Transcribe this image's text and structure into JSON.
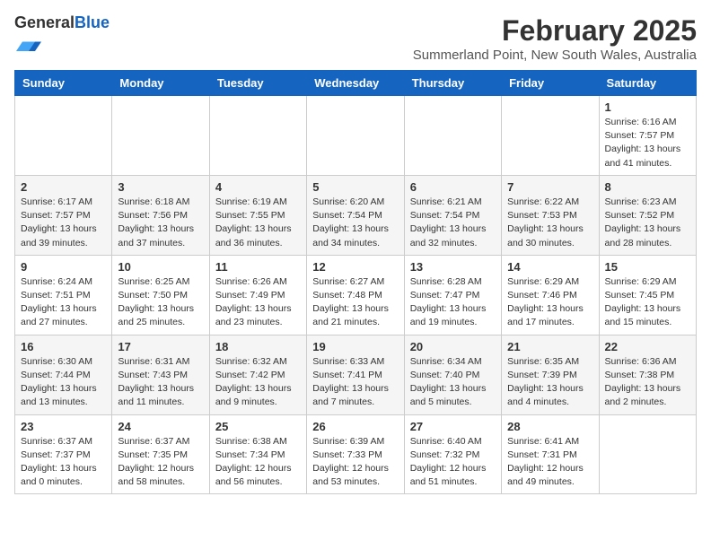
{
  "logo": {
    "general": "General",
    "blue": "Blue"
  },
  "header": {
    "title": "February 2025",
    "subtitle": "Summerland Point, New South Wales, Australia"
  },
  "weekdays": [
    "Sunday",
    "Monday",
    "Tuesday",
    "Wednesday",
    "Thursday",
    "Friday",
    "Saturday"
  ],
  "weeks": [
    [
      {
        "day": "",
        "info": ""
      },
      {
        "day": "",
        "info": ""
      },
      {
        "day": "",
        "info": ""
      },
      {
        "day": "",
        "info": ""
      },
      {
        "day": "",
        "info": ""
      },
      {
        "day": "",
        "info": ""
      },
      {
        "day": "1",
        "info": "Sunrise: 6:16 AM\nSunset: 7:57 PM\nDaylight: 13 hours\nand 41 minutes."
      }
    ],
    [
      {
        "day": "2",
        "info": "Sunrise: 6:17 AM\nSunset: 7:57 PM\nDaylight: 13 hours\nand 39 minutes."
      },
      {
        "day": "3",
        "info": "Sunrise: 6:18 AM\nSunset: 7:56 PM\nDaylight: 13 hours\nand 37 minutes."
      },
      {
        "day": "4",
        "info": "Sunrise: 6:19 AM\nSunset: 7:55 PM\nDaylight: 13 hours\nand 36 minutes."
      },
      {
        "day": "5",
        "info": "Sunrise: 6:20 AM\nSunset: 7:54 PM\nDaylight: 13 hours\nand 34 minutes."
      },
      {
        "day": "6",
        "info": "Sunrise: 6:21 AM\nSunset: 7:54 PM\nDaylight: 13 hours\nand 32 minutes."
      },
      {
        "day": "7",
        "info": "Sunrise: 6:22 AM\nSunset: 7:53 PM\nDaylight: 13 hours\nand 30 minutes."
      },
      {
        "day": "8",
        "info": "Sunrise: 6:23 AM\nSunset: 7:52 PM\nDaylight: 13 hours\nand 28 minutes."
      }
    ],
    [
      {
        "day": "9",
        "info": "Sunrise: 6:24 AM\nSunset: 7:51 PM\nDaylight: 13 hours\nand 27 minutes."
      },
      {
        "day": "10",
        "info": "Sunrise: 6:25 AM\nSunset: 7:50 PM\nDaylight: 13 hours\nand 25 minutes."
      },
      {
        "day": "11",
        "info": "Sunrise: 6:26 AM\nSunset: 7:49 PM\nDaylight: 13 hours\nand 23 minutes."
      },
      {
        "day": "12",
        "info": "Sunrise: 6:27 AM\nSunset: 7:48 PM\nDaylight: 13 hours\nand 21 minutes."
      },
      {
        "day": "13",
        "info": "Sunrise: 6:28 AM\nSunset: 7:47 PM\nDaylight: 13 hours\nand 19 minutes."
      },
      {
        "day": "14",
        "info": "Sunrise: 6:29 AM\nSunset: 7:46 PM\nDaylight: 13 hours\nand 17 minutes."
      },
      {
        "day": "15",
        "info": "Sunrise: 6:29 AM\nSunset: 7:45 PM\nDaylight: 13 hours\nand 15 minutes."
      }
    ],
    [
      {
        "day": "16",
        "info": "Sunrise: 6:30 AM\nSunset: 7:44 PM\nDaylight: 13 hours\nand 13 minutes."
      },
      {
        "day": "17",
        "info": "Sunrise: 6:31 AM\nSunset: 7:43 PM\nDaylight: 13 hours\nand 11 minutes."
      },
      {
        "day": "18",
        "info": "Sunrise: 6:32 AM\nSunset: 7:42 PM\nDaylight: 13 hours\nand 9 minutes."
      },
      {
        "day": "19",
        "info": "Sunrise: 6:33 AM\nSunset: 7:41 PM\nDaylight: 13 hours\nand 7 minutes."
      },
      {
        "day": "20",
        "info": "Sunrise: 6:34 AM\nSunset: 7:40 PM\nDaylight: 13 hours\nand 5 minutes."
      },
      {
        "day": "21",
        "info": "Sunrise: 6:35 AM\nSunset: 7:39 PM\nDaylight: 13 hours\nand 4 minutes."
      },
      {
        "day": "22",
        "info": "Sunrise: 6:36 AM\nSunset: 7:38 PM\nDaylight: 13 hours\nand 2 minutes."
      }
    ],
    [
      {
        "day": "23",
        "info": "Sunrise: 6:37 AM\nSunset: 7:37 PM\nDaylight: 13 hours\nand 0 minutes."
      },
      {
        "day": "24",
        "info": "Sunrise: 6:37 AM\nSunset: 7:35 PM\nDaylight: 12 hours\nand 58 minutes."
      },
      {
        "day": "25",
        "info": "Sunrise: 6:38 AM\nSunset: 7:34 PM\nDaylight: 12 hours\nand 56 minutes."
      },
      {
        "day": "26",
        "info": "Sunrise: 6:39 AM\nSunset: 7:33 PM\nDaylight: 12 hours\nand 53 minutes."
      },
      {
        "day": "27",
        "info": "Sunrise: 6:40 AM\nSunset: 7:32 PM\nDaylight: 12 hours\nand 51 minutes."
      },
      {
        "day": "28",
        "info": "Sunrise: 6:41 AM\nSunset: 7:31 PM\nDaylight: 12 hours\nand 49 minutes."
      },
      {
        "day": "",
        "info": ""
      }
    ]
  ]
}
